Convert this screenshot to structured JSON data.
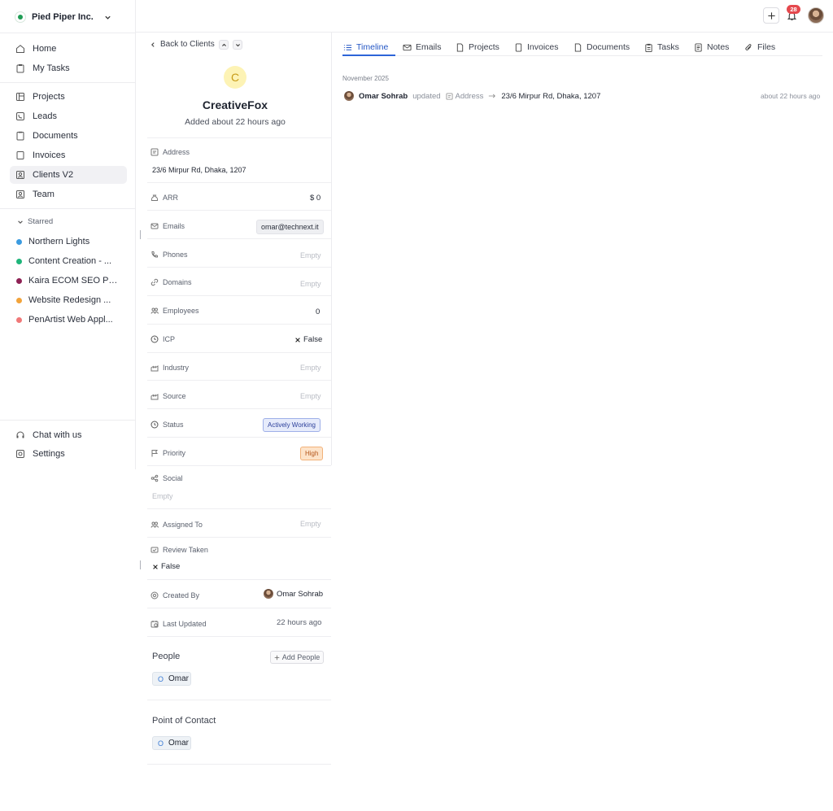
{
  "workspace": {
    "name": "Pied Piper Inc."
  },
  "nav": {
    "primary": [
      {
        "label": "Home",
        "icon": "home-icon"
      },
      {
        "label": "My Tasks",
        "icon": "clipboard-icon"
      }
    ],
    "secondary": [
      {
        "label": "Projects",
        "icon": "board-icon"
      },
      {
        "label": "Leads",
        "icon": "phone-icon"
      },
      {
        "label": "Documents",
        "icon": "document-icon"
      },
      {
        "label": "Invoices",
        "icon": "invoice-icon"
      },
      {
        "label": "Clients V2",
        "icon": "client-icon",
        "active": true
      },
      {
        "label": "Team",
        "icon": "team-icon"
      }
    ],
    "starred_label": "Starred",
    "starred": [
      {
        "label": "Northern Lights",
        "color": "#3b9be0"
      },
      {
        "label": "Content Creation - ...",
        "color": "#1fb57a"
      },
      {
        "label": "Kaira ECOM SEO Pr...",
        "color": "#8e2154"
      },
      {
        "label": "Website Redesign ...",
        "color": "#f2a33a"
      },
      {
        "label": "PenArtist Web Appl...",
        "color": "#f07878"
      }
    ],
    "bottom": [
      {
        "label": "Chat with us",
        "icon": "headset-icon"
      },
      {
        "label": "Settings",
        "icon": "settings-icon"
      }
    ]
  },
  "topbar": {
    "notification_count": "28"
  },
  "client": {
    "back_label": "Back to Clients",
    "avatar_initial": "C",
    "name": "CreativeFox",
    "added": "Added about 22 hours ago",
    "address_label": "Address",
    "address_value": "23/6 Mirpur Rd, Dhaka, 1207",
    "arr_label": "ARR",
    "arr_value": "$ 0",
    "emails_label": "Emails",
    "emails_value": "omar@technext.it",
    "phones_label": "Phones",
    "domains_label": "Domains",
    "employees_label": "Employees",
    "employees_value": "0",
    "icp_label": "ICP",
    "icp_value": "False",
    "industry_label": "Industry",
    "source_label": "Source",
    "status_label": "Status",
    "status_value": "Actively Working",
    "priority_label": "Priority",
    "priority_value": "High",
    "social_label": "Social",
    "assigned_label": "Assigned To",
    "review_label": "Review Taken",
    "review_value": "False",
    "created_label": "Created By",
    "created_value": "Omar Sohrab",
    "updated_label": "Last Updated",
    "updated_value": "22 hours ago",
    "empty_text": "Empty",
    "people_title": "People",
    "add_people": "Add People",
    "people": [
      {
        "initial": "O",
        "name": "Omar"
      }
    ],
    "poc_title": "Point of Contact",
    "poc": [
      {
        "initial": "O",
        "name": "Omar"
      }
    ]
  },
  "tabs": [
    "Timeline",
    "Emails",
    "Projects",
    "Invoices",
    "Documents",
    "Tasks",
    "Notes",
    "Files"
  ],
  "timeline": {
    "month": "November 2025",
    "entries": [
      {
        "user": "Omar Sohrab",
        "verb": "updated",
        "field": "Address",
        "value": "23/6 Mirpur Rd, Dhaka, 1207",
        "time": "about 22 hours ago"
      }
    ]
  }
}
